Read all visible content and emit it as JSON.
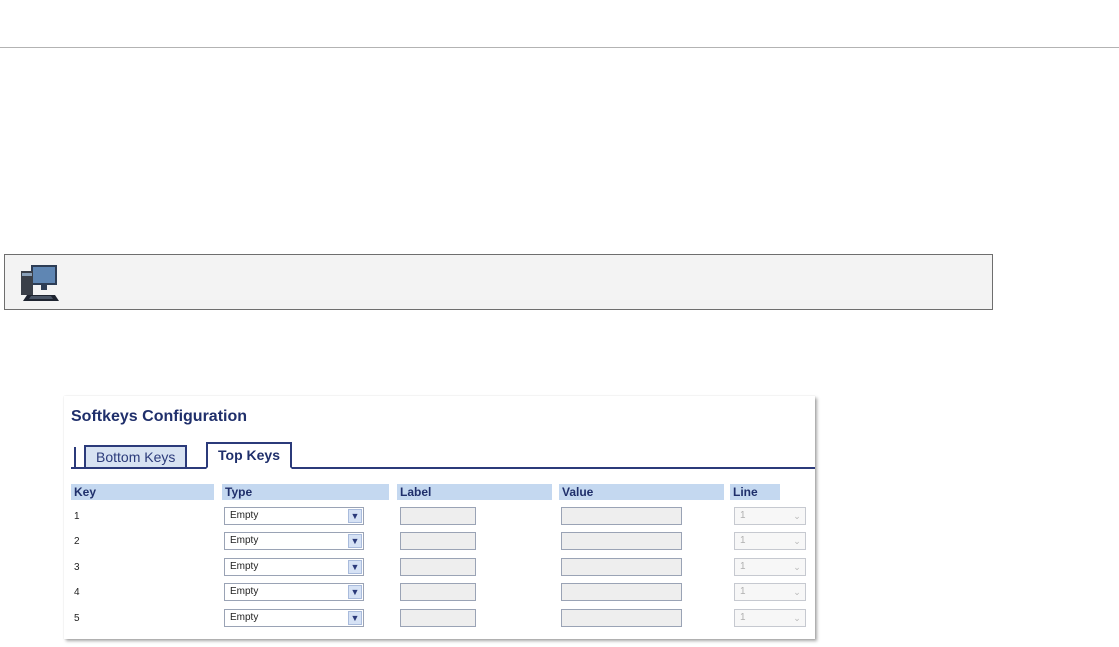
{
  "softkeys": {
    "title": "Softkeys Configuration",
    "tabs": [
      {
        "label": "Bottom Keys",
        "active": false
      },
      {
        "label": "Top Keys",
        "active": true
      }
    ],
    "columns": {
      "key": "Key",
      "type": "Type",
      "label": "Label",
      "value": "Value",
      "line": "Line"
    },
    "rows": [
      {
        "key": "1",
        "type": "Empty",
        "label": "",
        "value": "",
        "line": "1"
      },
      {
        "key": "2",
        "type": "Empty",
        "label": "",
        "value": "",
        "line": "1"
      },
      {
        "key": "3",
        "type": "Empty",
        "label": "",
        "value": "",
        "line": "1"
      },
      {
        "key": "4",
        "type": "Empty",
        "label": "",
        "value": "",
        "line": "1"
      },
      {
        "key": "5",
        "type": "Empty",
        "label": "",
        "value": "",
        "line": "1"
      }
    ]
  },
  "note": {
    "icon": "computer-icon"
  },
  "colors": {
    "accent": "#2b3a7a",
    "header_bg": "#c4d8f0",
    "tab_inactive_bg": "#d7e2f2"
  }
}
